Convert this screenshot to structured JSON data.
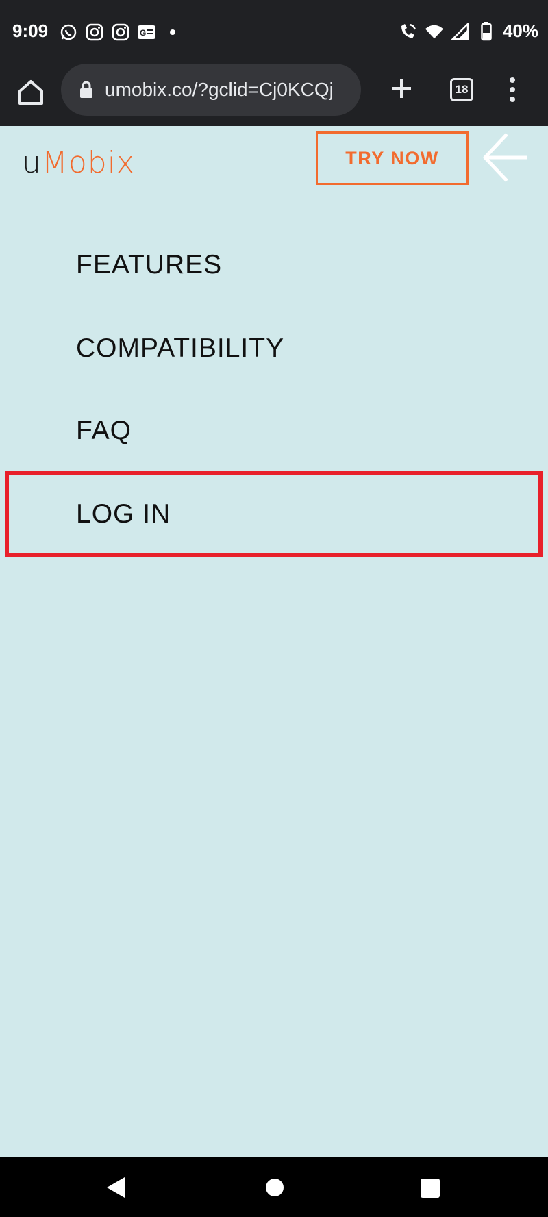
{
  "status_bar": {
    "time": "9:09",
    "left_icons": [
      "whatsapp-icon",
      "instagram-icon",
      "instagram-icon",
      "news-icon",
      "dot-icon"
    ],
    "right_icons": [
      "wifi-calling-icon",
      "wifi-icon",
      "signal-icon",
      "battery-icon"
    ],
    "battery": "40%"
  },
  "browser": {
    "url": "umobix.co/?gclid=Cj0KCQj",
    "tab_count": "18"
  },
  "header": {
    "logo_u": "u",
    "logo_rest": "Mobix",
    "cta_label": "TRY NOW"
  },
  "menu": {
    "items": [
      {
        "label": "FEATURES"
      },
      {
        "label": "COMPATIBILITY"
      },
      {
        "label": "FAQ"
      },
      {
        "label": "LOG IN"
      }
    ]
  },
  "colors": {
    "accent": "#f26b2e",
    "page_bg": "#d1e9eb",
    "highlight": "#e8202a",
    "chrome_bg": "#202124"
  }
}
